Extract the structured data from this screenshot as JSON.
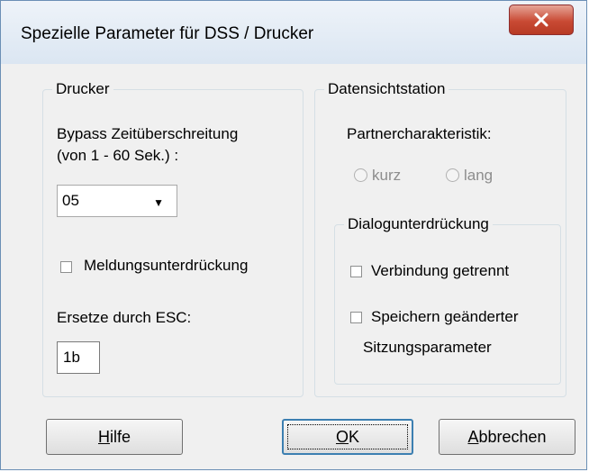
{
  "window": {
    "title": "Spezielle Parameter für DSS / Drucker",
    "close_icon": "close-icon"
  },
  "drucker": {
    "legend": "Drucker",
    "bypass_label_line1": "Bypass Zeitüberschreitung",
    "bypass_label_line2": "(von 1 - 60 Sek.) :",
    "bypass_value": "05",
    "meldung_label": "Meldungsunterdrückung",
    "meldung_checked": false,
    "ersetze_label": "Ersetze durch ESC:",
    "ersetze_value": "1b"
  },
  "dss": {
    "legend": "Datensichtstation",
    "partner_label": "Partnercharakteristik:",
    "radio_kurz": "kurz",
    "radio_lang": "lang",
    "dialog": {
      "legend": "Dialogunterdrückung",
      "verbindung_label": "Verbindung getrennt",
      "speichern_line1": "Speichern geänderter",
      "speichern_line2": "Sitzungsparameter"
    }
  },
  "buttons": {
    "hilfe_first": "H",
    "hilfe_rest": "ilfe",
    "ok_first": "O",
    "ok_rest": "K",
    "abbrechen_first": "A",
    "abbrechen_rest": "bbrechen"
  }
}
